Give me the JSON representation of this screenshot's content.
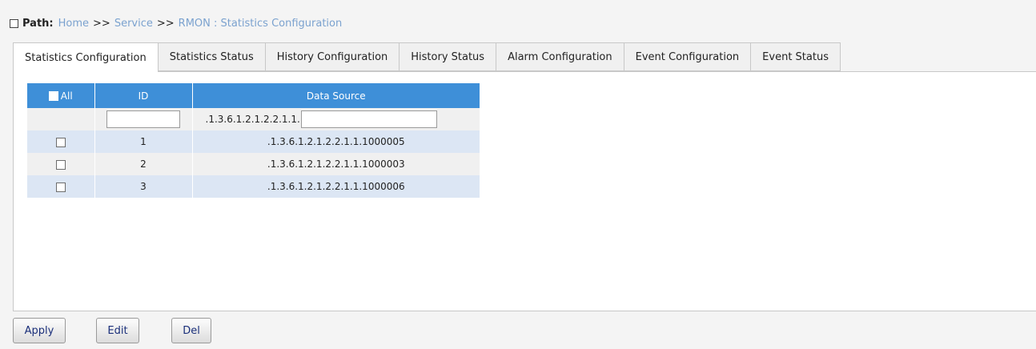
{
  "path": {
    "label": "Path:",
    "crumbs": [
      "Home",
      "Service",
      "RMON : Statistics Configuration"
    ],
    "separator": ">>"
  },
  "tabs": [
    {
      "label": "Statistics Configuration",
      "active": true
    },
    {
      "label": "Statistics Status",
      "active": false
    },
    {
      "label": "History Configuration",
      "active": false
    },
    {
      "label": "History Status",
      "active": false
    },
    {
      "label": "Alarm Configuration",
      "active": false
    },
    {
      "label": "Event Configuration",
      "active": false
    },
    {
      "label": "Event Status",
      "active": false
    }
  ],
  "table": {
    "headers": {
      "all": "All",
      "id": "ID",
      "data_source": "Data Source"
    },
    "input_row": {
      "id_value": "",
      "data_source_prefix": ".1.3.6.1.2.1.2.2.1.1.",
      "data_source_value": ""
    },
    "rows": [
      {
        "id": "1",
        "data_source": ".1.3.6.1.2.1.2.2.1.1.1000005",
        "checked": false
      },
      {
        "id": "2",
        "data_source": ".1.3.6.1.2.1.2.2.1.1.1000003",
        "checked": false
      },
      {
        "id": "3",
        "data_source": ".1.3.6.1.2.1.2.2.1.1.1000006",
        "checked": false
      }
    ]
  },
  "buttons": {
    "apply": "Apply",
    "edit": "Edit",
    "del": "Del"
  },
  "colors": {
    "header_bg": "#3e8fd8",
    "row_highlight": "#dce6f4",
    "link": "#7ba2cf"
  }
}
